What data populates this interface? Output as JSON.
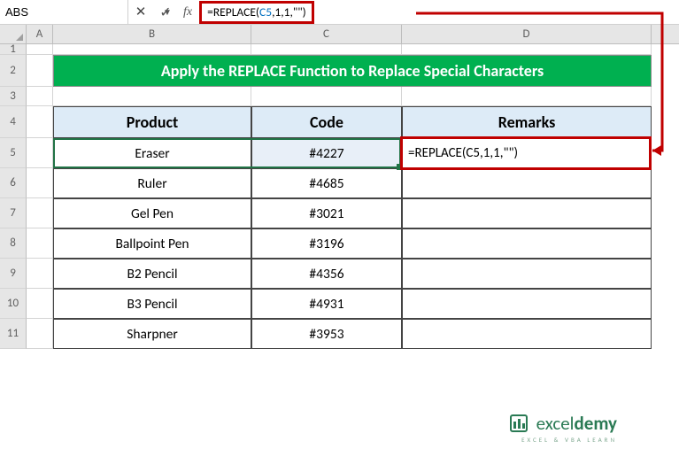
{
  "nameBox": "ABS",
  "formulaBar": {
    "prefix": "=",
    "fn": "REPLACE",
    "open": "(",
    "ref": "C5",
    "rest": ",1,1,\"\")"
  },
  "columns": {
    "A": "A",
    "B": "B",
    "C": "C",
    "D": "D"
  },
  "rowLabels": [
    "1",
    "2",
    "3",
    "4",
    "5",
    "6",
    "7",
    "8",
    "9",
    "10",
    "11"
  ],
  "title": "Apply the REPLACE Function to Replace Special Characters",
  "headers": {
    "product": "Product",
    "code": "Code",
    "remarks": "Remarks"
  },
  "table": [
    {
      "product": "Eraser",
      "code": "#4227"
    },
    {
      "product": "Ruler",
      "code": "#4685"
    },
    {
      "product": "Gel Pen",
      "code": "#3021"
    },
    {
      "product": "Ballpoint Pen",
      "code": "#3196"
    },
    {
      "product": "B2 Pencil",
      "code": "#4356"
    },
    {
      "product": "B3 Pencil",
      "code": "#4931"
    },
    {
      "product": "Sharpner",
      "code": "#3953"
    }
  ],
  "d5Text": "=REPLACE(C5,1,1,\"\")",
  "logo": {
    "brand1": "excel",
    "brand2": "demy",
    "tag": "EXCEL & VBA LEARN"
  },
  "chart_data": null
}
